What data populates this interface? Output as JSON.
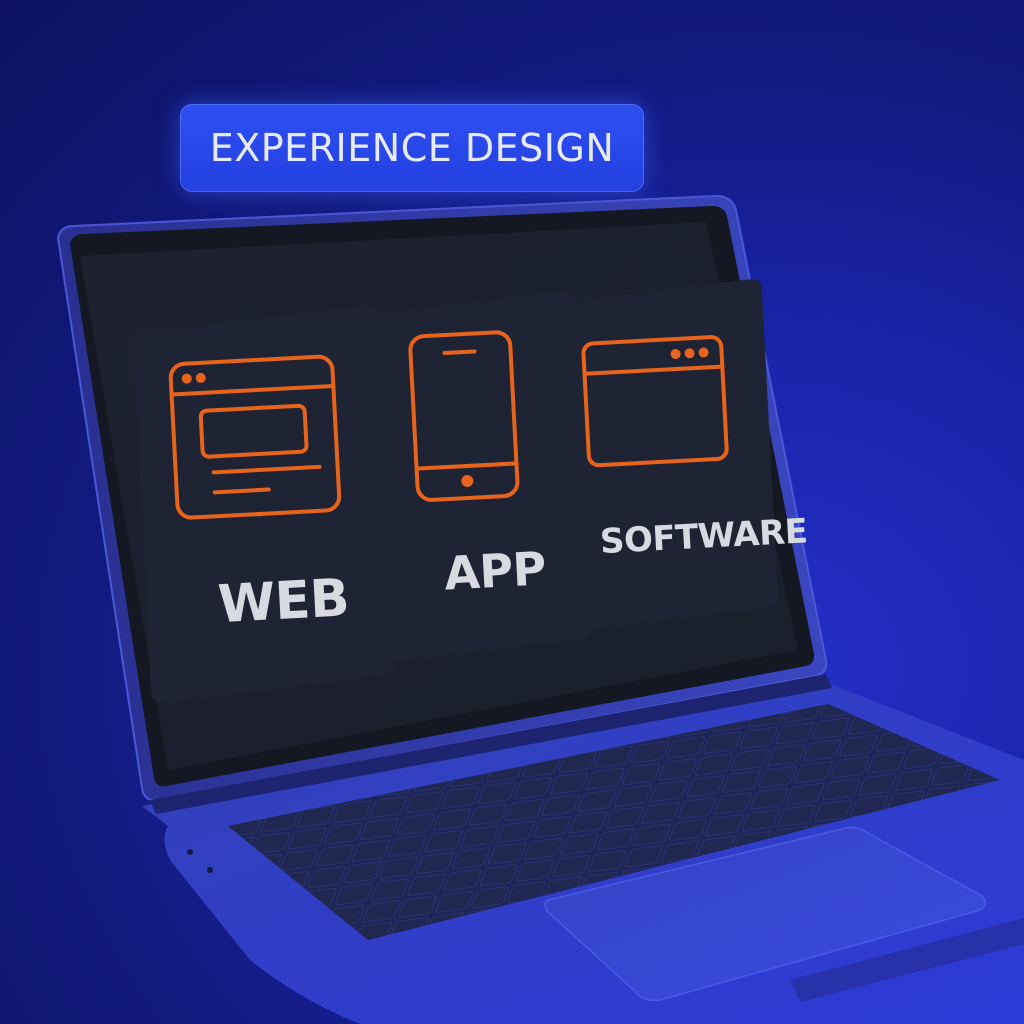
{
  "header": {
    "label": "EXPERIENCE DESIGN"
  },
  "screen": {
    "cards": [
      {
        "label": "WEB",
        "icon": "browser-window-icon"
      },
      {
        "label": "APP",
        "icon": "smartphone-icon"
      },
      {
        "label": "SOFTWARE",
        "icon": "application-window-icon"
      }
    ]
  },
  "colors": {
    "background": "#1a23a8",
    "pill": "#2a48ea",
    "icon_stroke": "#e8641c",
    "card": "#1f2434",
    "screen": "#1c2130",
    "laptop_body": "#3a4ac8",
    "label_text": "#d8dae2"
  }
}
